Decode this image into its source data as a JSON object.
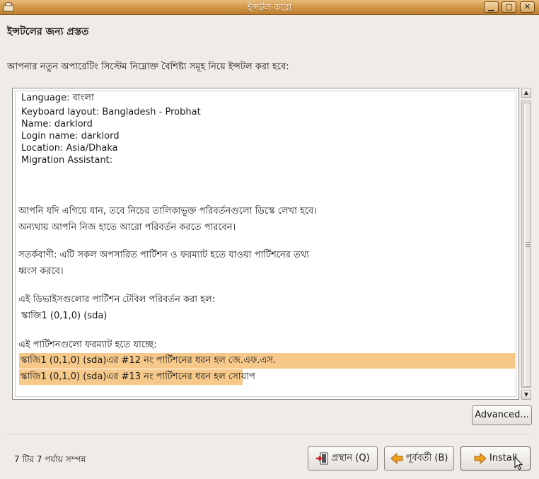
{
  "window": {
    "title": "ইন্সটল করো"
  },
  "page": {
    "heading": "ইন্সটলের জন্য প্রস্তত",
    "intro": "আপনার নতুন অপারেটিং সিস্টেম নিম্নোক্ত বৈশিষ্ট্য সমূহ নিয়ে ইন্সটল করা হবে:"
  },
  "summary": {
    "language": "Language: বাংলা",
    "keyboard": "Keyboard layout: Bangladesh - Probhat",
    "name": "Name: darklord",
    "login": "Login name: darklord",
    "location": "Location: Asia/Dhaka",
    "migration": "Migration Assistant:",
    "write_note_1": "আপনি যদি এগিয়ে যান, তবে নিচের তালিকাভূক্ত পরিবর্তনগুলো ডিস্কে লেখা হবে।",
    "write_note_2": "অন্যথায় আপনি নিজ হাতে আরো পরিবর্তন করতে পারবেন।",
    "warning_1": "সতর্কবাণী: এটি সকল অপসারিত পার্টিশন ও ফরম্যাট হতে যাওয়া পার্টিশনের তথ্য",
    "warning_2": "ধ্বংস করবে।",
    "table_heading": "এই ডিভাইসগুলোর পার্টিশন টেবিল পরিবর্তন করা হল:",
    "table_device": "স্কাজি1 (0,1,0) (sda)",
    "format_heading": "এই পার্টিশনগুলো ফরম্যাট হতে যাচ্ছে:",
    "format_1": "স্কাজি1 (0,1,0) (sda)এর #12 নং পার্টিশনের ধরন হল জে.এফ.এস.",
    "format_2": "স্কাজি1 (0,1,0) (sda)এর #13 নং পার্টিশনের ধরন হল সোয়াপ"
  },
  "buttons": {
    "advanced": "Advanced...",
    "quit": "প্রস্থান (Q)",
    "back": "পূর্ববর্তী (B)",
    "install": "Install"
  },
  "status": {
    "step": "7 টির 7 পর্যায় সম্পন্ন"
  },
  "colors": {
    "titlebar": "#d59b4c",
    "highlight": "#f6c98b"
  },
  "icons": {
    "app": "installer-icon",
    "minimize": "minimize-icon",
    "maximize": "maximize-icon",
    "close": "close-icon",
    "quit": "exit-icon",
    "back": "arrow-left-icon",
    "install": "arrow-right-icon"
  }
}
